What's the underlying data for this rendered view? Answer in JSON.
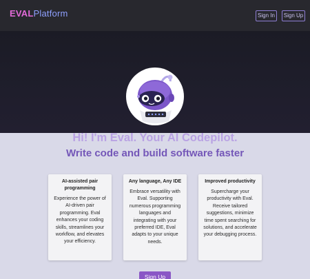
{
  "nav": {
    "logo_part1": "EVAL",
    "logo_part2": "Platform",
    "sign_in": "Sign In",
    "sign_up": "Sign Up"
  },
  "hero": {
    "title": "Hi! I'm Eval. Your AI Codepilot."
  },
  "features": {
    "heading": "Write code and build software faster",
    "cards": [
      {
        "title": "AI-assisted pair programming",
        "body": "Experience the power of AI-driven pair programming. Eval enhances your coding skills, streamlines your workflow, and elevates your efficiency."
      },
      {
        "title": "Any language, Any IDE",
        "body": "Embrace versatility with Eval. Supporting numerous programming languages and integrating with your preferred IDE, Eval adapts to your unique needs."
      },
      {
        "title": "Improved productivity",
        "body": "Supercharge your productivity with Eval. Receive tailored suggestions, minimize time spent searching for solutions, and accelerate your debugging process."
      }
    ],
    "cta": "Sign Up"
  },
  "colors": {
    "nav_bg": "#28282e",
    "hero_bg": "#1f1e2c",
    "accent": "#8a56c6",
    "hero_title": "#b9a2e3",
    "section_title": "#7457b8",
    "page_bg": "#d9d9e8"
  },
  "icons": {
    "avatar": "robot-mascot-icon"
  }
}
